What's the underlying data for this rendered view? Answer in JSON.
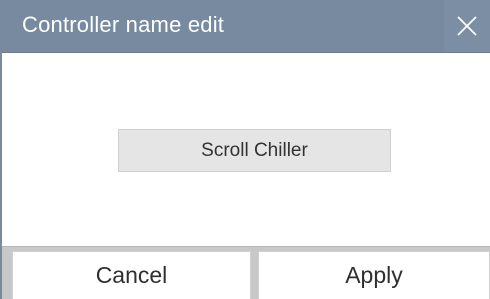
{
  "dialog": {
    "title": "Controller name edit",
    "close_icon": "close-icon"
  },
  "name_field": {
    "value": "Scroll Chiller"
  },
  "footer": {
    "cancel_label": "Cancel",
    "apply_label": "Apply"
  },
  "colors": {
    "titlebar": "#778aa0",
    "field_bg": "#e5e5e5",
    "footer_bg": "#c8c8c8"
  }
}
